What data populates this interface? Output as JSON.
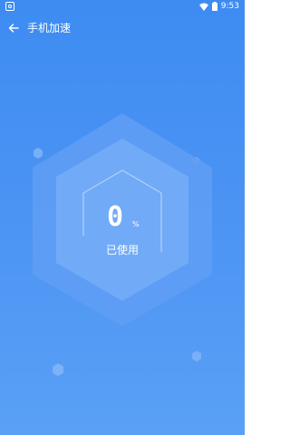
{
  "status_bar": {
    "time": "9:53",
    "icons": [
      "app-notification-icon",
      "wifi-icon",
      "battery-icon"
    ]
  },
  "app_bar": {
    "back_icon": "arrow-left-icon",
    "title": "手机加速"
  },
  "usage": {
    "value": "0",
    "unit": "%",
    "label": "已使用",
    "fraction_used": 0
  },
  "colors": {
    "background_top": "#3d8cf2",
    "background_bottom": "#5aa0f6",
    "hexagon_fill": "#6aa9f7",
    "foreground": "#ffffff"
  }
}
